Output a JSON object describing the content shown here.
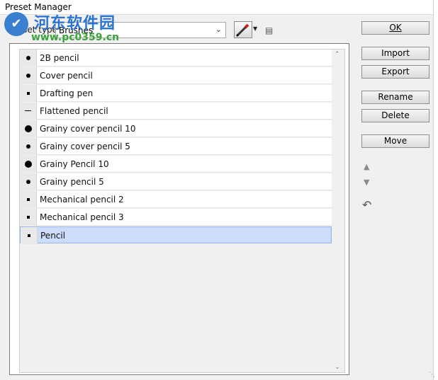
{
  "window": {
    "title": "Preset Manager"
  },
  "preset": {
    "label": "Preset type:",
    "selected": "Brushes"
  },
  "toolbar": {
    "brush_icon": "pencil-brush-icon",
    "dropdown_icon": "triangle-down-icon",
    "options_icon": "panel-options-icon"
  },
  "brushes": [
    {
      "name": "2B pencil",
      "thumb": "dot-md"
    },
    {
      "name": "Cover pencil",
      "thumb": "dot-md"
    },
    {
      "name": "Drafting pen",
      "thumb": "dot-sm"
    },
    {
      "name": "Flattened pencil",
      "thumb": "dash"
    },
    {
      "name": "Grainy cover pencil 10",
      "thumb": "dot-lg"
    },
    {
      "name": "Grainy cover pencil 5",
      "thumb": "dot-md"
    },
    {
      "name": "Grainy Pencil 10",
      "thumb": "dot-lg"
    },
    {
      "name": "Grainy pencil 5",
      "thumb": "dot-md"
    },
    {
      "name": "Mechanical pencil 2",
      "thumb": "dot-sm"
    },
    {
      "name": "Mechanical pencil 3",
      "thumb": "dot-sm"
    },
    {
      "name": "Pencil",
      "thumb": "dot-sm",
      "selected": true
    }
  ],
  "buttons": {
    "ok": "OK",
    "import": "Import",
    "export": "Export",
    "rename": "Rename",
    "delete": "Delete",
    "move": "Move"
  },
  "watermark": {
    "site_name": "河东软件园",
    "url": "www.pc0359.cn"
  },
  "colors": {
    "selection": "#ccdcfa",
    "watermark_blue": "#2b74d0",
    "watermark_green": "#3aa33a"
  }
}
